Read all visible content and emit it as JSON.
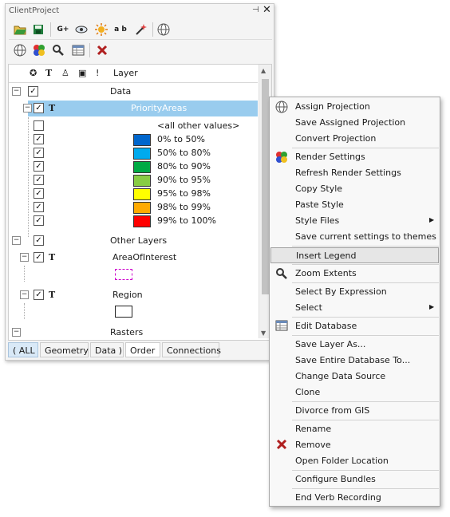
{
  "panel": {
    "title": "ClientProject",
    "pin_glyph": "⊣",
    "close_glyph": "✕"
  },
  "toolbar1": {
    "icons": [
      "open-folder-icon",
      "save-icon",
      "add-layer-icon",
      "view-icon",
      "sun-icon",
      "label-icon",
      "magic-wand-icon",
      "globe-icon"
    ],
    "add_layer_text": "G+",
    "label_text": "a b"
  },
  "toolbar2": {
    "icons": [
      "globe-icon",
      "render-icon",
      "search-icon",
      "table-icon",
      "remove-icon"
    ]
  },
  "header": {
    "col_layer": "Layer",
    "col_t": "T",
    "col_excl": "!"
  },
  "tree": {
    "data_group": "Data",
    "priority_layer": "PriorityAreas",
    "all_other": "<all other values>",
    "legend": [
      {
        "label": "0% to 50%",
        "color": "#0066cc"
      },
      {
        "label": "50% to 80%",
        "color": "#00aaee"
      },
      {
        "label": "80% to 90%",
        "color": "#00aa44"
      },
      {
        "label": "90% to 95%",
        "color": "#88cc44"
      },
      {
        "label": "95% to 98%",
        "color": "#ffff00"
      },
      {
        "label": "98% to 99%",
        "color": "#ffaa00"
      },
      {
        "label": "99% to 100%",
        "color": "#ff0000"
      }
    ],
    "other_group": "Other Layers",
    "area_layer": "AreaOfInterest",
    "region_layer": "Region",
    "rasters_group": "Rasters",
    "t_glyph": "T"
  },
  "tabs": [
    "( ALL",
    "Geometry",
    "Data )",
    "Order",
    "Connections"
  ],
  "menu": {
    "items": [
      {
        "label": "Assign Projection",
        "icon": "globe-icon"
      },
      {
        "label": "Save Assigned Projection"
      },
      {
        "label": "Convert Projection"
      },
      {
        "label": "Render Settings",
        "icon": "render-icon"
      },
      {
        "label": "Refresh Render Settings"
      },
      {
        "label": "Copy Style"
      },
      {
        "label": "Paste Style"
      },
      {
        "label": "Style Files",
        "submenu": true
      },
      {
        "label": "Save current settings to themes"
      },
      {
        "label": "Insert Legend",
        "highlighted": true
      },
      {
        "label": "Zoom Extents",
        "icon": "search-icon"
      },
      {
        "label": "Select By Expression"
      },
      {
        "label": "Select",
        "submenu": true
      },
      {
        "label": "Edit Database",
        "icon": "table-icon"
      },
      {
        "label": "Save Layer As..."
      },
      {
        "label": "Save Entire Database To..."
      },
      {
        "label": "Change Data Source"
      },
      {
        "label": "Clone"
      },
      {
        "label": "Divorce from GIS"
      },
      {
        "label": "Rename"
      },
      {
        "label": "Remove",
        "icon": "remove-icon"
      },
      {
        "label": "Open Folder Location"
      },
      {
        "label": "Configure Bundles"
      },
      {
        "label": "End Verb Recording"
      }
    ],
    "submenu_glyph": "▶"
  },
  "colors": {
    "selection": "#99ccee",
    "menu_highlight": "#e6e6e6",
    "area_dash": "#cc00cc"
  }
}
